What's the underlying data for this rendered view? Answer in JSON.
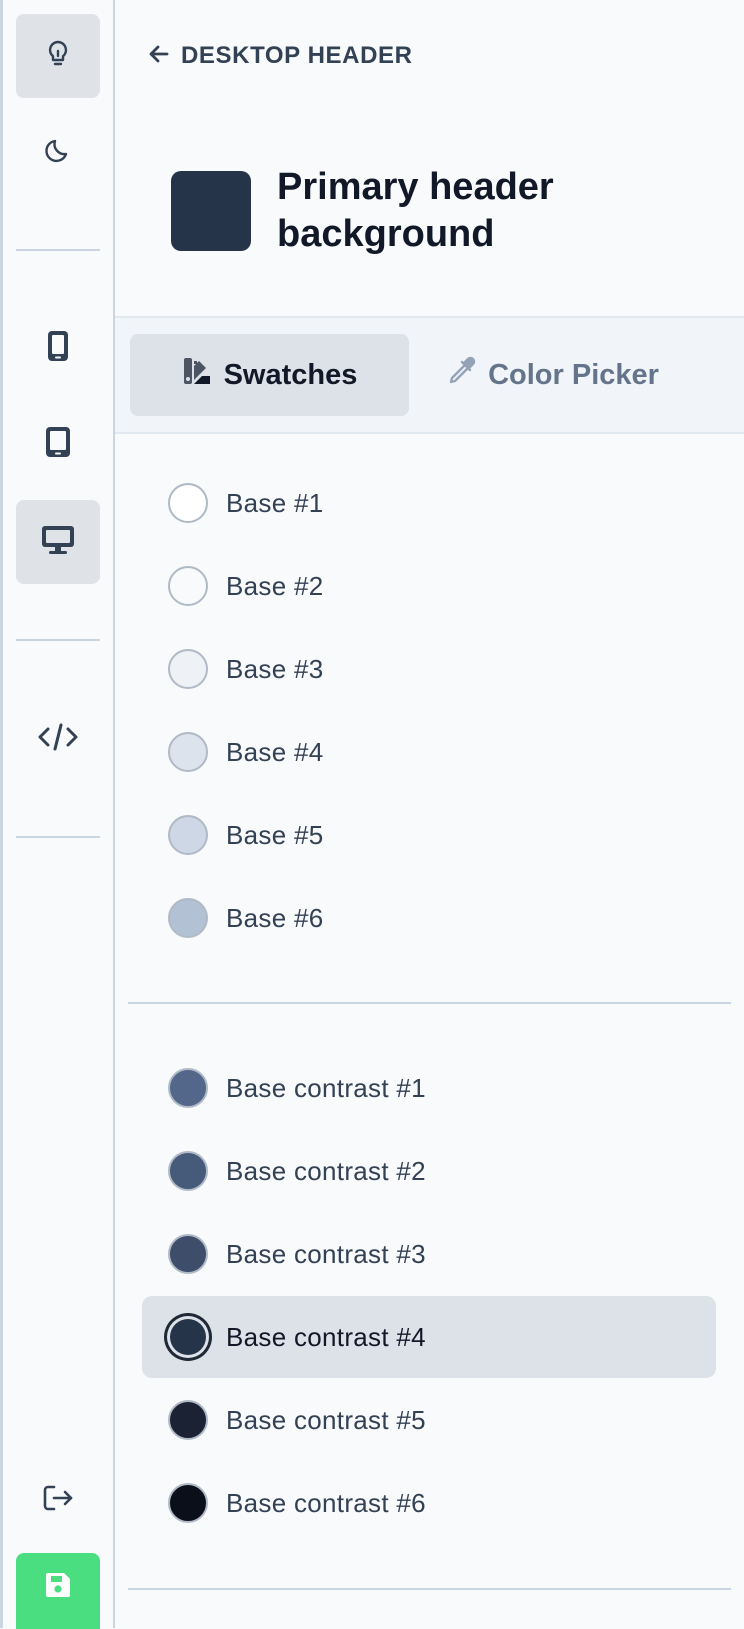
{
  "sidebar": {
    "icons": [
      "lightbulb-icon",
      "moon-icon",
      "mobile-icon",
      "tablet-icon",
      "desktop-icon",
      "code-icon",
      "logout-icon",
      "save-icon"
    ],
    "save_color": "#4ade80"
  },
  "header": {
    "back_label": "DESKTOP HEADER",
    "title": "Primary header background",
    "title_swatch_color": "#263449"
  },
  "tabs": [
    {
      "label": "Swatches",
      "icon": "swatches-icon",
      "active": true
    },
    {
      "label": "Color Picker",
      "icon": "eyedropper-icon",
      "active": false
    }
  ],
  "base_swatches": [
    {
      "label": "Base #1",
      "color": "#ffffff"
    },
    {
      "label": "Base #2",
      "color": "#f8fafc"
    },
    {
      "label": "Base #3",
      "color": "#eef2f7"
    },
    {
      "label": "Base #4",
      "color": "#dde3ec"
    },
    {
      "label": "Base #5",
      "color": "#cdd7e6"
    },
    {
      "label": "Base #6",
      "color": "#b3c1d5"
    }
  ],
  "contrast_swatches": [
    {
      "label": "Base contrast #1",
      "color": "#53678a"
    },
    {
      "label": "Base contrast #2",
      "color": "#465a7a"
    },
    {
      "label": "Base contrast #3",
      "color": "#3d4d6a"
    },
    {
      "label": "Base contrast #4",
      "color": "#263449",
      "selected": true
    },
    {
      "label": "Base contrast #5",
      "color": "#1a2233"
    },
    {
      "label": "Base contrast #6",
      "color": "#0a0f1a"
    }
  ]
}
